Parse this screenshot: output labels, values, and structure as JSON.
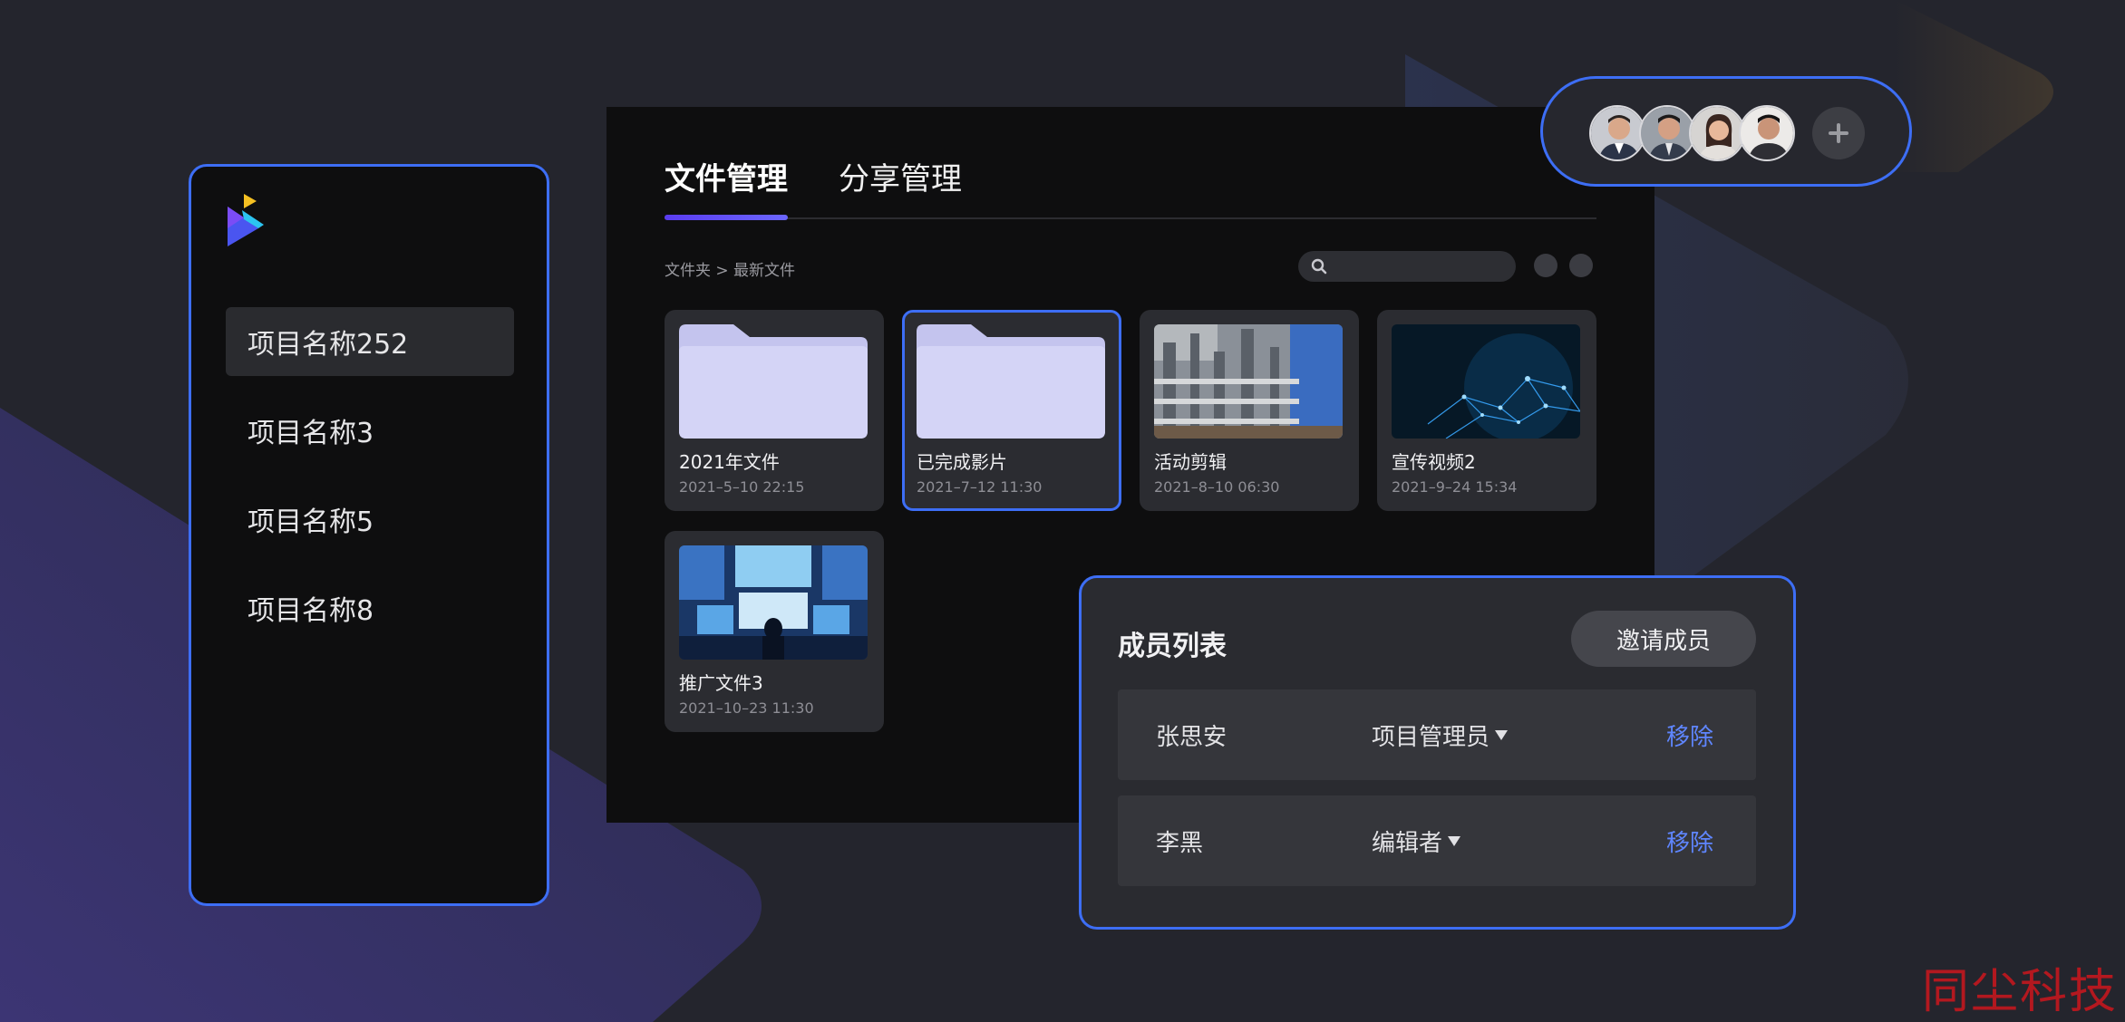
{
  "sidebar": {
    "items": [
      {
        "label": "项目名称252",
        "active": true
      },
      {
        "label": "项目名称3",
        "active": false
      },
      {
        "label": "项目名称5",
        "active": false
      },
      {
        "label": "项目名称8",
        "active": false
      }
    ]
  },
  "main": {
    "tabs": [
      {
        "label": "文件管理",
        "active": true
      },
      {
        "label": "分享管理",
        "active": false
      }
    ],
    "breadcrumb": "文件夹 > 最新文件",
    "search": {
      "placeholder": ""
    },
    "files": [
      {
        "title": "2021年文件",
        "date": "2021–5–10 22:15",
        "kind": "folder",
        "selected": false
      },
      {
        "title": "已完成影片",
        "date": "2021–7–12 11:30",
        "kind": "folder",
        "selected": true
      },
      {
        "title": "活动剪辑",
        "date": "2021–8–10 06:30",
        "kind": "building-photo",
        "selected": false
      },
      {
        "title": "宣传视频2",
        "date": "2021–9–24 15:34",
        "kind": "network-photo",
        "selected": false
      },
      {
        "title": "推广文件3",
        "date": "2021–10–23 11:30",
        "kind": "screens-photo",
        "selected": false
      }
    ]
  },
  "avatars": {
    "count": 4,
    "add_icon": "plus-icon"
  },
  "members": {
    "title": "成员列表",
    "invite_label": "邀请成员",
    "rows": [
      {
        "name": "张思安",
        "role": "项目管理员",
        "remove_label": "移除"
      },
      {
        "name": "李黑",
        "role": "编辑者",
        "remove_label": "移除"
      }
    ]
  },
  "watermark": "同尘科技",
  "colors": {
    "accent_border": "#3d6ef5",
    "link": "#5f86ff",
    "folder": "#d2d2f5",
    "tab_indicator": "#5a3cf0",
    "watermark": "#b3181f"
  }
}
